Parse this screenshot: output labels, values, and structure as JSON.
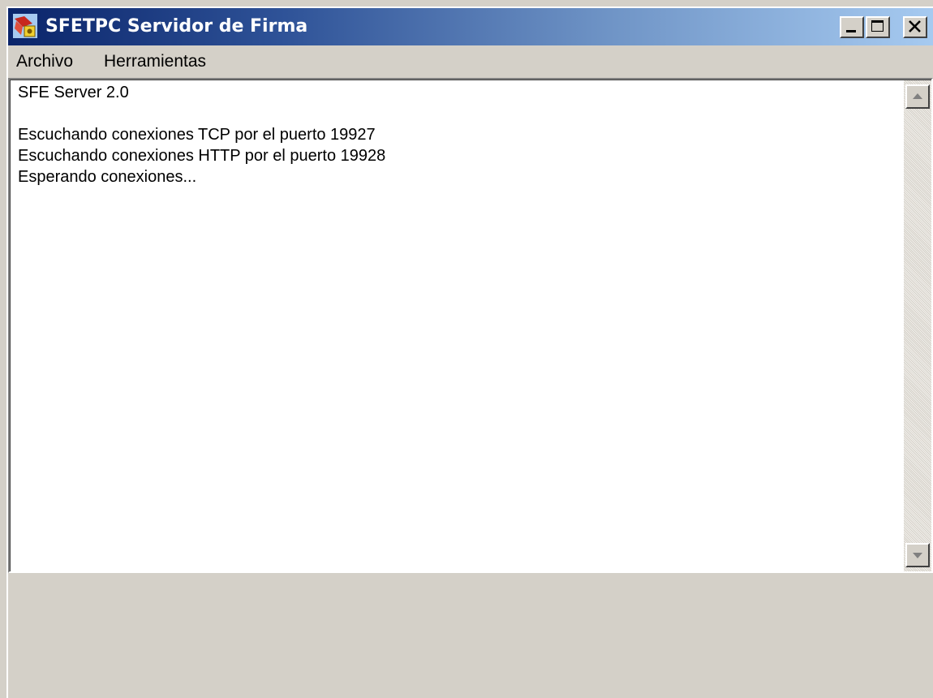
{
  "window": {
    "title": "SFETPC Servidor de Firma",
    "icon": "sfe-app-icon",
    "controls": [
      "minimize-icon",
      "maximize-icon",
      "close-icon"
    ]
  },
  "menu": {
    "archivo": "Archivo",
    "herramientas": "Herramientas"
  },
  "log": {
    "lines": [
      "SFE Server 2.0",
      "",
      "Escuchando conexiones TCP por el puerto 19927",
      "Escuchando conexiones HTTP por el puerto 19928",
      "Esperando conexiones..."
    ]
  },
  "scrollbar": {
    "up_icon": "scroll-up-arrow-icon",
    "down_icon": "scroll-down-arrow-icon"
  },
  "colors": {
    "titlebar_start": "#0a246a",
    "titlebar_end": "#a6caf0",
    "face": "#d4d0c8",
    "text_background": "#ffffff"
  }
}
